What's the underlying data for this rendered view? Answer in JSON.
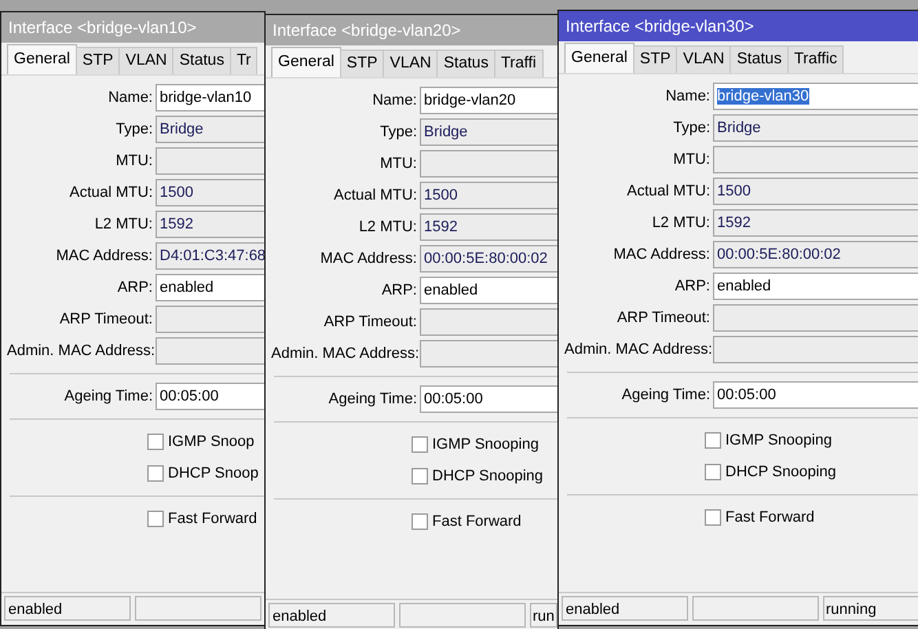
{
  "windows": [
    {
      "title": "Interface <bridge-vlan10>",
      "active": false,
      "tabs": [
        {
          "label": "General",
          "selected": true
        },
        {
          "label": "STP",
          "selected": false
        },
        {
          "label": "VLAN",
          "selected": false
        },
        {
          "label": "Status",
          "selected": false
        },
        {
          "label": "Tr",
          "selected": false
        }
      ],
      "sections": [
        [
          {
            "kind": "field",
            "label": "Name:",
            "value": "bridge-vlan10",
            "editable": true,
            "highlighted": false
          },
          {
            "kind": "field",
            "label": "Type:",
            "value": "Bridge",
            "editable": false
          },
          {
            "kind": "field",
            "label": "MTU:",
            "editable": false
          },
          {
            "kind": "field",
            "label": "Actual MTU:",
            "value": "1500",
            "editable": false
          },
          {
            "kind": "field",
            "label": "L2 MTU:",
            "value": "1592",
            "editable": false
          },
          {
            "kind": "field",
            "label": "MAC Address:",
            "value": "D4:01:C3:47:68",
            "editable": false
          },
          {
            "kind": "field",
            "label": "ARP:",
            "value": "enabled",
            "editable": true
          },
          {
            "kind": "field",
            "label": "ARP Timeout:",
            "editable": false
          },
          {
            "kind": "field",
            "label": "Admin. MAC Address:",
            "editable": false
          }
        ],
        [
          {
            "kind": "field",
            "label": "Ageing Time:",
            "value": "00:05:00",
            "editable": true
          }
        ],
        [
          {
            "kind": "checkbox",
            "label": "IGMP Snoop",
            "checked": false
          },
          {
            "kind": "checkbox",
            "label": "DHCP Snoop",
            "checked": false
          }
        ],
        [
          {
            "kind": "checkbox",
            "label": "Fast Forward",
            "checked": false
          }
        ]
      ],
      "status_bar": {
        "cell_1": "enabled"
      }
    },
    {
      "title": "Interface <bridge-vlan20>",
      "active": false,
      "tabs": [
        {
          "label": "General",
          "selected": true
        },
        {
          "label": "STP",
          "selected": false
        },
        {
          "label": "VLAN",
          "selected": false
        },
        {
          "label": "Status",
          "selected": false
        },
        {
          "label": "Traffi",
          "selected": false
        }
      ],
      "sections": [
        [
          {
            "kind": "field",
            "label": "Name:",
            "value": "bridge-vlan20",
            "editable": true,
            "highlighted": false
          },
          {
            "kind": "field",
            "label": "Type:",
            "value": "Bridge",
            "editable": false
          },
          {
            "kind": "field",
            "label": "MTU:",
            "editable": false
          },
          {
            "kind": "field",
            "label": "Actual MTU:",
            "value": "1500",
            "editable": false
          },
          {
            "kind": "field",
            "label": "L2 MTU:",
            "value": "1592",
            "editable": false
          },
          {
            "kind": "field",
            "label": "MAC Address:",
            "value": "00:00:5E:80:00:02",
            "editable": false
          },
          {
            "kind": "field",
            "label": "ARP:",
            "value": "enabled",
            "editable": true
          },
          {
            "kind": "field",
            "label": "ARP Timeout:",
            "editable": false
          },
          {
            "kind": "field",
            "label": "Admin. MAC Address:",
            "editable": false
          }
        ],
        [
          {
            "kind": "field",
            "label": "Ageing Time:",
            "value": "00:05:00",
            "editable": true
          }
        ],
        [
          {
            "kind": "checkbox",
            "label": "IGMP Snooping",
            "checked": false
          },
          {
            "kind": "checkbox",
            "label": "DHCP Snooping",
            "checked": false
          }
        ],
        [
          {
            "kind": "checkbox",
            "label": "Fast Forward",
            "checked": false
          }
        ]
      ],
      "status_bar": {
        "cell_1": "enabled",
        "cell_3": "run"
      }
    },
    {
      "title": "Interface <bridge-vlan30>",
      "active": true,
      "tabs": [
        {
          "label": "General",
          "selected": true
        },
        {
          "label": "STP",
          "selected": false
        },
        {
          "label": "VLAN",
          "selected": false
        },
        {
          "label": "Status",
          "selected": false
        },
        {
          "label": "Traffic",
          "selected": false
        }
      ],
      "sections": [
        [
          {
            "kind": "field",
            "label": "Name:",
            "value": "bridge-vlan30",
            "editable": true,
            "highlighted": true
          },
          {
            "kind": "field",
            "label": "Type:",
            "value": "Bridge",
            "editable": false
          },
          {
            "kind": "field",
            "label": "MTU:",
            "editable": false
          },
          {
            "kind": "field",
            "label": "Actual MTU:",
            "value": "1500",
            "editable": false
          },
          {
            "kind": "field",
            "label": "L2 MTU:",
            "value": "1592",
            "editable": false
          },
          {
            "kind": "field",
            "label": "MAC Address:",
            "value": "00:00:5E:80:00:02",
            "editable": false
          },
          {
            "kind": "field",
            "label": "ARP:",
            "value": "enabled",
            "editable": true
          },
          {
            "kind": "field",
            "label": "ARP Timeout:",
            "editable": false
          },
          {
            "kind": "field",
            "label": "Admin. MAC Address:",
            "editable": false
          }
        ],
        [
          {
            "kind": "field",
            "label": "Ageing Time:",
            "value": "00:05:00",
            "editable": true
          }
        ],
        [
          {
            "kind": "checkbox",
            "label": "IGMP Snooping",
            "checked": false
          },
          {
            "kind": "checkbox",
            "label": "DHCP Snooping",
            "checked": false
          }
        ],
        [
          {
            "kind": "checkbox",
            "label": "Fast Forward",
            "checked": false
          }
        ]
      ],
      "status_bar": {
        "cell_1": "enabled",
        "cell_3": "running"
      }
    }
  ]
}
